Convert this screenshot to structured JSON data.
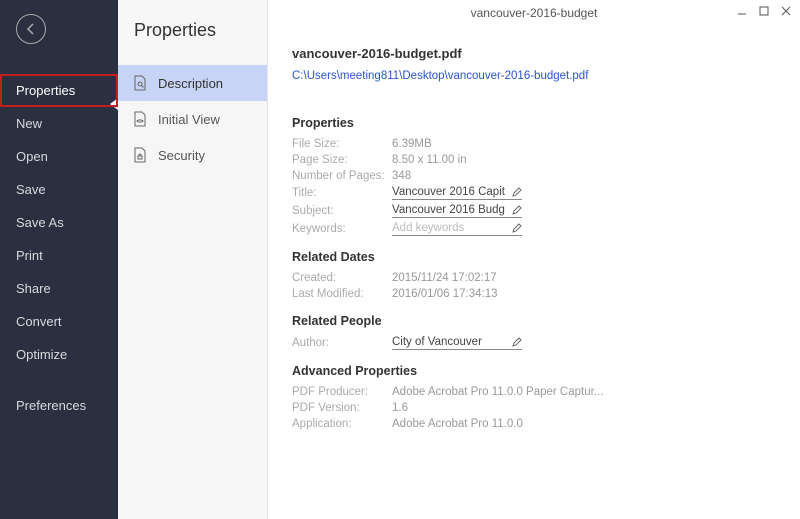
{
  "window": {
    "title": "vancouver-2016-budget"
  },
  "sidebar": {
    "items": [
      {
        "label": "Properties"
      },
      {
        "label": "New"
      },
      {
        "label": "Open"
      },
      {
        "label": "Save"
      },
      {
        "label": "Save As"
      },
      {
        "label": "Print"
      },
      {
        "label": "Share"
      },
      {
        "label": "Convert"
      },
      {
        "label": "Optimize"
      },
      {
        "label": "Preferences"
      }
    ]
  },
  "panel": {
    "title": "Properties",
    "tabs": [
      {
        "label": "Description"
      },
      {
        "label": "Initial View"
      },
      {
        "label": "Security"
      }
    ]
  },
  "file": {
    "name": "vancouver-2016-budget.pdf",
    "path": "C:\\Users\\meeting811\\Desktop\\vancouver-2016-budget.pdf"
  },
  "sections": {
    "properties": {
      "heading": "Properties",
      "file_size_label": "File Size:",
      "file_size": "6.39MB",
      "page_size_label": "Page Size:",
      "page_size": "8.50 x 11.00 in",
      "pages_label": "Number of Pages:",
      "pages": "348",
      "title_label": "Title:",
      "title": "Vancouver 2016 Capit",
      "subject_label": "Subject:",
      "subject": "Vancouver 2016 Budg",
      "keywords_label": "Keywords:",
      "keywords_placeholder": "Add keywords"
    },
    "dates": {
      "heading": "Related Dates",
      "created_label": "Created:",
      "created": "2015/11/24 17:02:17",
      "modified_label": "Last Modified:",
      "modified": "2016/01/06 17:34:13"
    },
    "people": {
      "heading": "Related People",
      "author_label": "Author:",
      "author": "City of Vancouver"
    },
    "advanced": {
      "heading": "Advanced Properties",
      "producer_label": "PDF Producer:",
      "producer": "Adobe Acrobat Pro 11.0.0 Paper Captur...",
      "version_label": "PDF Version:",
      "version": "1.6",
      "app_label": "Application:",
      "app": "Adobe Acrobat Pro 11.0.0"
    }
  }
}
